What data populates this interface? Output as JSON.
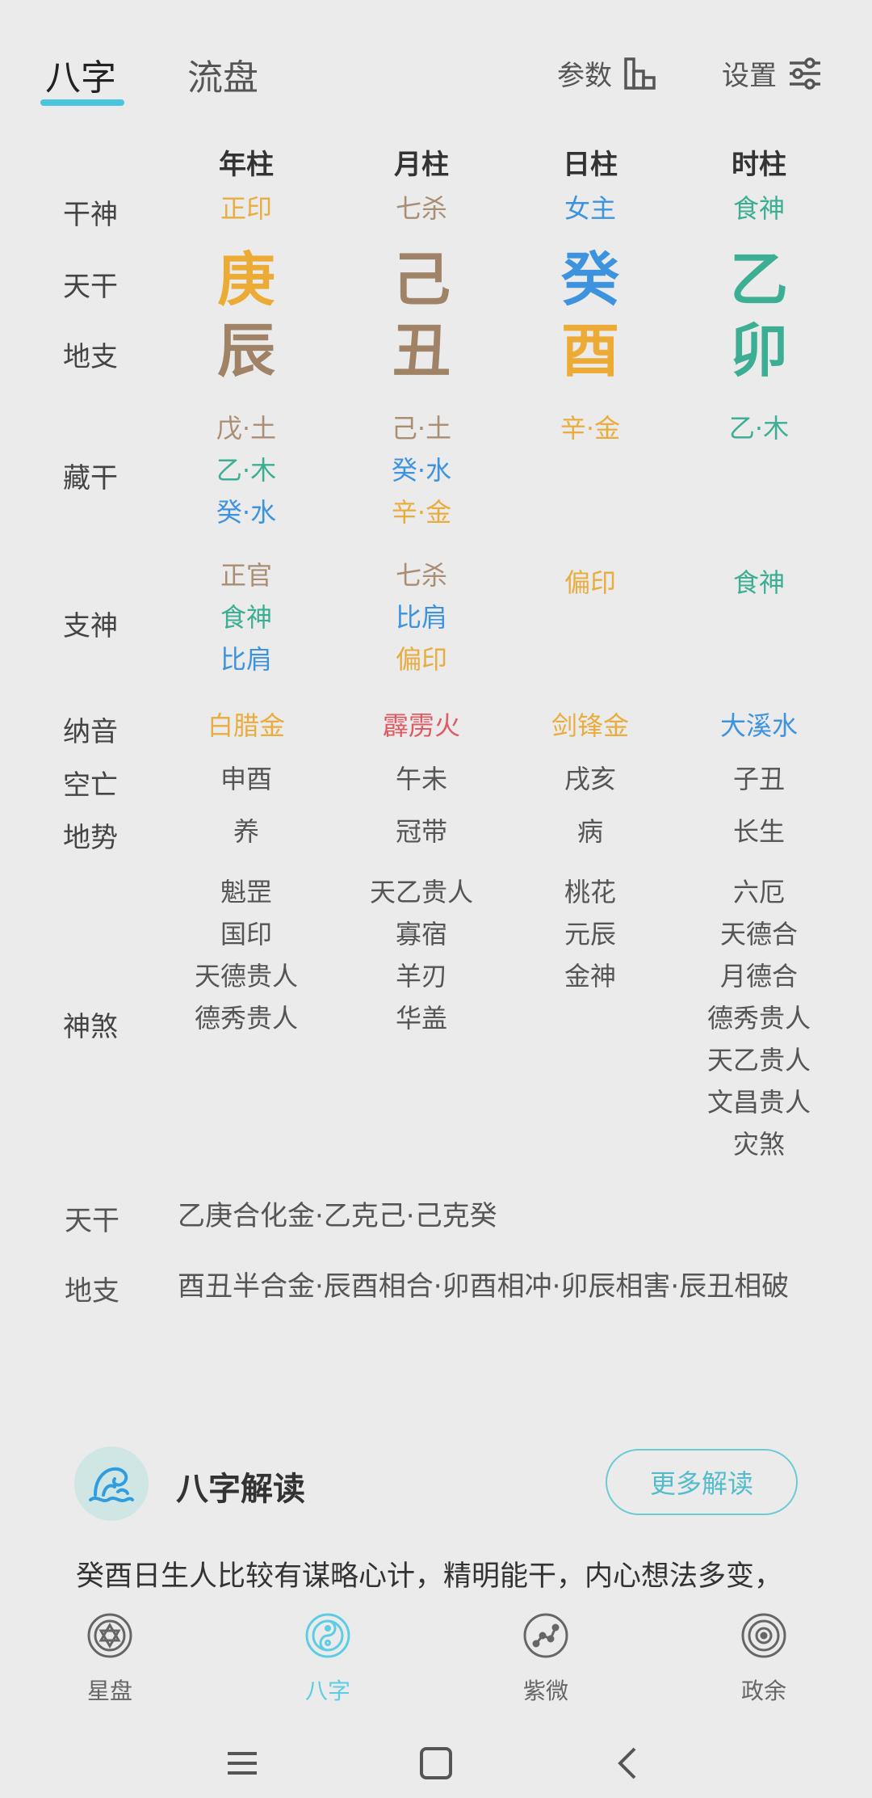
{
  "tabs": {
    "bazi": "八字",
    "liupan": "流盘"
  },
  "top_buttons": {
    "params": "参数",
    "settings": "设置"
  },
  "columns": [
    "年柱",
    "月柱",
    "日柱",
    "时柱"
  ],
  "row_labels": {
    "ganshen": "干神",
    "tiangan": "天干",
    "dizhi": "地支",
    "canggan": "藏干",
    "zhishen": "支神",
    "nayin": "纳音",
    "kongwang": "空亡",
    "dishi": "地势",
    "shensha": "神煞"
  },
  "ganshen": [
    "正印",
    "七杀",
    "女主",
    "食神"
  ],
  "tiangan": [
    "庚",
    "己",
    "癸",
    "乙"
  ],
  "dizhi": [
    "辰",
    "丑",
    "酉",
    "卯"
  ],
  "canggan": [
    [
      "戊·土",
      "乙·木",
      "癸·水"
    ],
    [
      "己·土",
      "癸·水",
      "辛·金"
    ],
    [
      "辛·金"
    ],
    [
      "乙·木"
    ]
  ],
  "zhishen": [
    [
      "正官",
      "食神",
      "比肩"
    ],
    [
      "七杀",
      "比肩",
      "偏印"
    ],
    [
      "偏印"
    ],
    [
      "食神"
    ]
  ],
  "nayin": [
    "白腊金",
    "霹雳火",
    "剑锋金",
    "大溪水"
  ],
  "kongwang": [
    "申酉",
    "午未",
    "戌亥",
    "子丑"
  ],
  "dishi": [
    "养",
    "冠带",
    "病",
    "长生"
  ],
  "shensha": [
    [
      "魁罡",
      "国印",
      "天德贵人",
      "德秀贵人"
    ],
    [
      "天乙贵人",
      "寡宿",
      "羊刃",
      "华盖"
    ],
    [
      "桃花",
      "元辰",
      "金神"
    ],
    [
      "六厄",
      "天德合",
      "月德合",
      "德秀贵人",
      "天乙贵人",
      "文昌贵人",
      "灾煞"
    ]
  ],
  "relations": {
    "tiangan_label": "天干",
    "tiangan_text": "乙庚合化金·乙克己·己克癸",
    "dizhi_label": "地支",
    "dizhi_text": "酉丑半合金·辰酉相合·卯酉相冲·卯辰相害·辰丑相破"
  },
  "interpretation": {
    "title": "八字解读",
    "more_button": "更多解读",
    "text": "癸酉日生人比较有谋略心计，精明能干，内心想法多变，"
  },
  "bottom_nav": [
    {
      "label": "星盘",
      "icon": "star-chart-icon"
    },
    {
      "label": "八字",
      "icon": "yin-yang-icon"
    },
    {
      "label": "紫微",
      "icon": "constellation-icon"
    },
    {
      "label": "政余",
      "icon": "target-icon"
    }
  ],
  "colors": {
    "accent": "#4ac4df",
    "earth": "#a98e74",
    "wood": "#3cae94",
    "water": "#3e93df",
    "metal": "#e8ad3e",
    "fire": "#e05a63"
  }
}
